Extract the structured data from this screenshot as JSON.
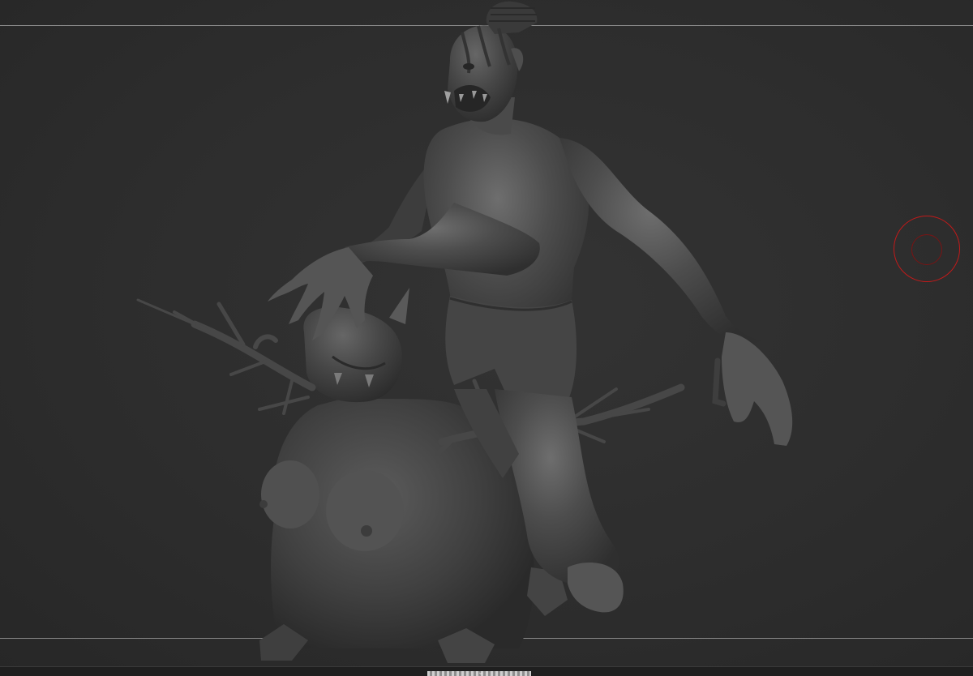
{
  "app": {
    "name": "",
    "view": "sculpt-viewport"
  },
  "viewport": {
    "background_color": "#2d2d2d",
    "frame_line_color": "#8a8a8a",
    "model_color": "#4a4a4a",
    "model_highlight_color": "#6b6b6b"
  },
  "scene": {
    "subjects": [
      "ape-headed-brute",
      "obese-ogre-creature",
      "branching-antlers",
      "rock-base"
    ]
  },
  "brush_cursor": {
    "outer_color": "#c21a1a",
    "inner_color": "#7a1414",
    "icon": "brush-circle-icon"
  },
  "bottom_bar": {
    "handle_glyph": "⌄"
  }
}
